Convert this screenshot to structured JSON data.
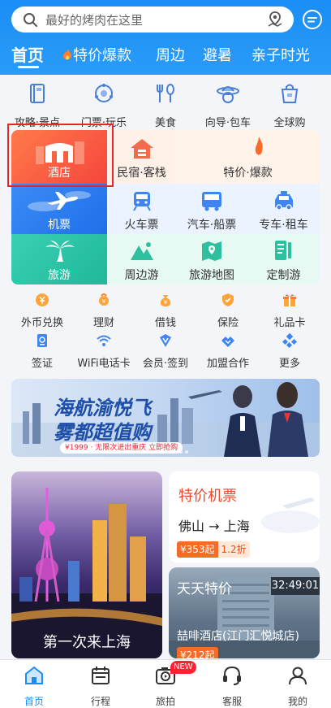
{
  "search": {
    "placeholder": "最好的烤肉在这里"
  },
  "tabs": [
    {
      "label": "首页",
      "active": true
    },
    {
      "label": "特价爆款",
      "icon": "fire-icon"
    },
    {
      "label": "周边"
    },
    {
      "label": "避暑"
    },
    {
      "label": "亲子时光"
    }
  ],
  "quick_nav": [
    {
      "label": "攻略·景点",
      "icon": "guide-book-icon"
    },
    {
      "label": "门票·玩乐",
      "icon": "ticket-icon"
    },
    {
      "label": "美食",
      "icon": "food-icon"
    },
    {
      "label": "向导·包车",
      "icon": "guide-hat-icon"
    },
    {
      "label": "全球购",
      "icon": "shopping-bag-icon"
    }
  ],
  "grid": {
    "hotel": "酒店",
    "minsu": "民宿·客栈",
    "tejia": "特价·爆款",
    "jipiao": "机票",
    "huoche": "火车票",
    "qiche": "汽车·船票",
    "zhuanche": "专车·租车",
    "lvyou": "旅游",
    "zhoubian": "周边游",
    "ditu": "旅游地图",
    "dingzhi": "定制游"
  },
  "services_row1": [
    {
      "label": "外币兑换",
      "icon": "currency-icon"
    },
    {
      "label": "理财",
      "icon": "finance-icon"
    },
    {
      "label": "借钱",
      "icon": "money-bag-icon"
    },
    {
      "label": "保险",
      "icon": "insurance-icon"
    },
    {
      "label": "礼品卡",
      "icon": "gift-icon"
    }
  ],
  "services_row2": [
    {
      "label": "签证",
      "icon": "visa-icon"
    },
    {
      "label": "WiFi电话卡",
      "icon": "wifi-icon"
    },
    {
      "label": "会员·签到",
      "icon": "vip-icon"
    },
    {
      "label": "加盟合作",
      "icon": "handshake-icon"
    },
    {
      "label": "更多",
      "icon": "more-icon"
    }
  ],
  "banner": {
    "line1": "海航渝悦飞",
    "line2": "雾都超值购",
    "promo": "¥1999 · 无限次进出重庆  立即抢购"
  },
  "promo_card": {
    "title": "第一次来上海"
  },
  "flight_card": {
    "heading": "特价机票",
    "route": "佛山 → 上海",
    "price": "¥353起",
    "discount": "1.2折"
  },
  "daily_card": {
    "heading": "天天特价",
    "countdown": "32:49:01",
    "hotel": "喆啡酒店(江门汇悦城店)",
    "price": "¥212起"
  },
  "bottom_nav": [
    {
      "label": "首页",
      "icon": "home-icon",
      "active": true
    },
    {
      "label": "行程",
      "icon": "calendar-icon"
    },
    {
      "label": "旅拍",
      "icon": "camera-play-icon",
      "badge": "NEW"
    },
    {
      "label": "客服",
      "icon": "headset-icon"
    },
    {
      "label": "我的",
      "icon": "user-icon"
    }
  ],
  "colors": {
    "brand_blue": "#1a8ef5",
    "hotel_red": "#f5463d",
    "highlight_border": "#e5272a",
    "price_orange": "#f36c2a"
  }
}
